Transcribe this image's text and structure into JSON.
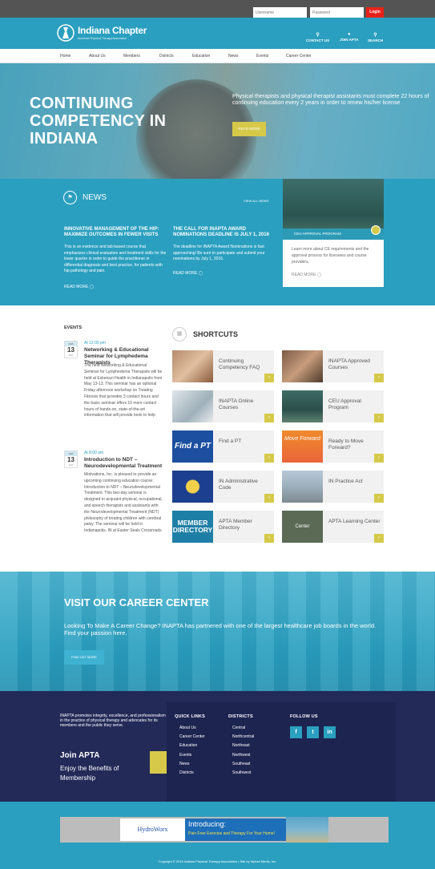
{
  "login": {
    "username_placeholder": "Username",
    "password_placeholder": "Password",
    "button": "Login"
  },
  "header": {
    "brand": "Indiana Chapter",
    "sub": "American Physical Therapy Association",
    "contact": "CONTACT US",
    "join": "JOIN APTA",
    "search": "SEARCH"
  },
  "nav": [
    "Home",
    "About Us",
    "Members",
    "Districts",
    "Education",
    "News",
    "Events",
    "Career Center"
  ],
  "hero": {
    "line1": "CONTINUING",
    "line2": "COMPETENCY IN",
    "line3": "INDIANA",
    "text": "Physical therapists and physical therapist assistants must complete 22 hours of continuing education every 2 years in order to renew his/her license",
    "button": "READ MORE"
  },
  "news": {
    "title": "NEWS",
    "view_all": "VIEW ALL NEWS",
    "items": [
      {
        "headline": "INNOVATIVE MANAGEMENT OF THE HIP: MAXIMIZE OUTCOMES IN FEWER VISITS",
        "body": "This is an evidence and lab-based course that emphasizes clinical evaluation and treatment skills for the lower quarter in order to guide the practitioner in differential diagnosis and best practice, for patients with hip pathology and pain.",
        "more": "READ MORE"
      },
      {
        "headline": "THE CALL FOR INAPTA AWARD NOMINATIONS DEADLINE IS JULY 1, 2016",
        "body": "The deadline for INAPTA Award Nominations is fast approaching! Be sure to participate and submit your nominations by July 1, 2016.",
        "more": "READ MORE"
      }
    ],
    "feature": {
      "caption": "CEU APPROVAL PROGRAM",
      "body": "Learn more about CE requirements and the approval process for licensees and course providers.",
      "more": "READ MORE"
    }
  },
  "events": {
    "title": "EVENTS",
    "items": [
      {
        "month": "FEB",
        "day": "13",
        "year": "2017",
        "time": "At 12:00 pm",
        "title": "Networking & Educational Seminar for Lymphedema Therapists",
        "body": "The next Networking & Educational Seminar for Lymphedema Therapists will be held at Eskenazi Health in Indianapolis from May 13-13. This seminar has an optional Friday afternoon workshop on Treating Fibrosis that provides 3 contact hours and the basic seminar offers 10 more contact hours of hands-on, state-of-the-art information that will provide tools to help"
      },
      {
        "month": "FEB",
        "day": "13",
        "year": "2017",
        "time": "At 8:00 am",
        "title": "Introduction to NDT – Neurodevelopmental Treatment",
        "body": "Motivations, Inc. is pleased to provide an upcoming continuing education course: Introduction to NDT – Neurodevelopmental Treatment. This two-day seminar is designed to acquaint physical, occupational, and speech therapists and assistants with the Neurodevelopmental Treatment (NDT) philosophy of treating children with cerebral palsy. The seminar will be held in Indianapolis, IN at Easter Seals Crossroads"
      }
    ]
  },
  "shortcuts": {
    "title": "SHORTCUTS",
    "items": [
      {
        "label": "Continuing Competency FAQ",
        "icon": "photo-woman-thumb"
      },
      {
        "label": "INAPTA Approved Courses",
        "icon": "photo-student-thumb"
      },
      {
        "label": "INAPTA Online Courses",
        "icon": "photo-laptop-thumb"
      },
      {
        "label": "CEU Approval Program",
        "icon": "photo-classroom-thumb"
      },
      {
        "label": "Find a PT",
        "icon": "find-a-pt-logo",
        "logo_text": "Find a PT"
      },
      {
        "label": "Ready to Move Forward?",
        "icon": "move-forward-logo",
        "logo_text": "Move Forward"
      },
      {
        "label": "IN Administrative Code",
        "icon": "indiana-flag"
      },
      {
        "label": "IN Practice Act",
        "icon": "capitol-photo"
      },
      {
        "label": "APTA Member Directory",
        "icon": "member-directory-logo",
        "logo_text": "MEMBER DIRECTORY"
      },
      {
        "label": "APTA Learning Center",
        "icon": "learning-center-logo",
        "logo_text": "Center"
      }
    ]
  },
  "career": {
    "title": "VISIT OUR CAREER CENTER",
    "text": "Looking To Make A Career Change? INAPTA has partnered with one of the largest healthcare job boards in the world. Find your passion here.",
    "button": "FIND OUT MORE"
  },
  "footer": {
    "intro": "INAPTA promotes integrity, excellence, and professionalism in the practice of physical therapy and advocates for its members and the public they serve.",
    "join_title": "Join APTA",
    "join_sub": "Enjoy the Benefits of Membership",
    "quick_title": "QUICK LINKS",
    "quick": [
      "About Us",
      "Career Center",
      "Education",
      "Events",
      "News",
      "Districts"
    ],
    "districts_title": "DISTRICTS",
    "districts": [
      "Central",
      "Northcentral",
      "Northeast",
      "Northwest",
      "Southeast",
      "Southwest"
    ],
    "follow_title": "FOLLOW US",
    "social": [
      "f",
      "t",
      "in"
    ]
  },
  "sponsor": {
    "logo": "HydroWorx",
    "headline": "Introducing:",
    "sub": "Pain Free Exercise and Therapy For Your Home!"
  },
  "copyright": "Copyright © 2015 Indiana Physical Therapy Association | Site by Myriad Media, Inc.",
  "colors": {
    "primary": "#2a9fbf",
    "accent": "#d6c94a",
    "footer": "#232a58",
    "login": "#e8221a"
  }
}
